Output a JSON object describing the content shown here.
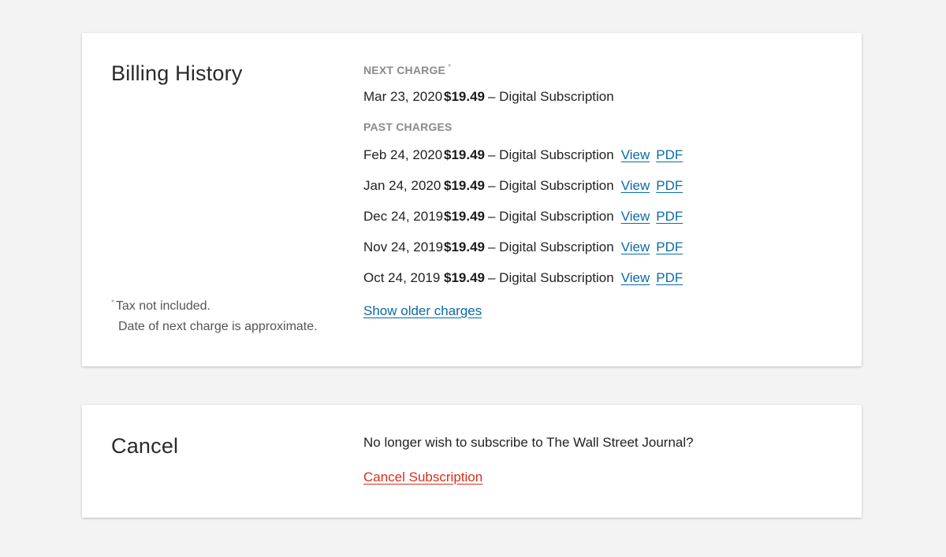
{
  "billing": {
    "title": "Billing History",
    "next_charge_label": "NEXT CHARGE",
    "next_charge_asterisk": "*",
    "next_charge": {
      "date": "Mar 23, 2020",
      "amount": "$19.49",
      "description": "– Digital Subscription"
    },
    "past_charges_label": "PAST CHARGES",
    "past_charges": [
      {
        "date": "Feb 24, 2020",
        "amount": "$19.49",
        "description": "– Digital Subscription",
        "view_label": "View",
        "pdf_label": "PDF"
      },
      {
        "date": "Jan 24, 2020",
        "amount": "$19.49",
        "description": "– Digital Subscription",
        "view_label": "View",
        "pdf_label": "PDF"
      },
      {
        "date": "Dec 24, 2019",
        "amount": "$19.49",
        "description": "– Digital Subscription",
        "view_label": "View",
        "pdf_label": "PDF"
      },
      {
        "date": "Nov 24, 2019",
        "amount": "$19.49",
        "description": "– Digital Subscription",
        "view_label": "View",
        "pdf_label": "PDF"
      },
      {
        "date": "Oct 24, 2019",
        "amount": "$19.49",
        "description": "– Digital Subscription",
        "view_label": "View",
        "pdf_label": "PDF"
      }
    ],
    "show_older_label": "Show older charges",
    "footnote": {
      "asterisk": "*",
      "line1": "Tax not included.",
      "line2": "Date of next charge is approximate."
    }
  },
  "cancel": {
    "title": "Cancel",
    "question": "No longer wish to subscribe to The Wall Street Journal?",
    "link_label": "Cancel Subscription"
  },
  "colors": {
    "link": "#0b6aa8",
    "danger": "#d52f1c",
    "eyebrow": "#8a8a8a",
    "background": "#f3f3f3",
    "card": "#ffffff"
  }
}
